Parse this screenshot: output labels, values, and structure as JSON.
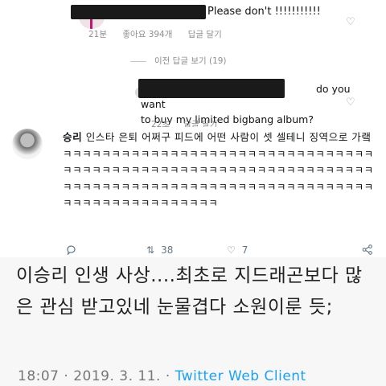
{
  "instagram": {
    "comment1": {
      "text": "Please don't !!!!!!!!!!!",
      "time": "21분",
      "likes": "좋아요 394개",
      "reply_label": "답글 달기"
    },
    "view_previous": "이전 답글 보기 (19)",
    "reply": {
      "text_line1": "do you want",
      "text_line2": "to buy my limited bigbang album?",
      "time": "22초",
      "reply_label": "답글 달기"
    },
    "icons": [
      "heart-icon"
    ],
    "colors": {
      "meta": "#8e8e8e",
      "redaction": "#1a1a1a"
    }
  },
  "tweet": {
    "author": "승리",
    "body": "인스타 은퇴 어쩌구 피드에 어떤 사람이 셋 셀테니 징역으로 가랰ㅋㅋㅋㅋㅋㅋㅋㅋㅋㅋㅋㅋㅋㅋㅋㅋㅋㅋㅋㅋㅋㅋㅋㅋㅋㅋㅋㅋㅋㅋㅋㅋㅋㅋㅋㅋㅋㅋㅋㅋㅋㅋㅋㅋㅋㅋㅋㅋㅋㅋㅋㅋㅋㅋㅋㅋㅋㅋㅋㅋㅋㅋㅋㅋㅋㅋㅋㅋㅋㅋㅋㅋㅋㅋㅋㅋㅋㅋㅋㅋㅋㅋㅋㅋㅋㅋㅋㅋㅋㅋㅋㅋㅋㅋㅋㅋㅋㅋㅋㅋㅋㅋㅋㅋㅋㅋㅋㅋㅋㅋㅋㅋ",
    "retweets": "38",
    "likes": "7",
    "icons": [
      "reply-icon",
      "retweet-icon",
      "like-icon",
      "share-icon"
    ],
    "colors": {
      "text": "#14171a",
      "actions": "#657786"
    }
  },
  "zoomed": {
    "text": "이승리 인생 사상....최초로 지드래곤보다 많은 관심 받고있네 눈물겹다 소원이룬 듯;",
    "timestamp": "18:07 · 2019. 3. 11. · ",
    "client": "Twitter Web Client",
    "colors": {
      "client": "#1da1f2"
    }
  }
}
